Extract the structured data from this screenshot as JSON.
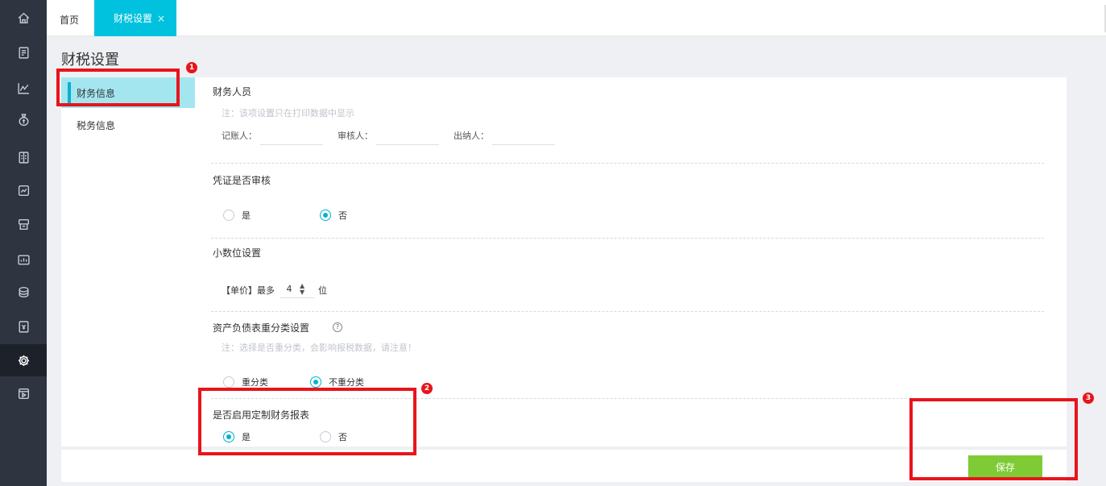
{
  "nav": {
    "icons": [
      "home-icon",
      "document-icon",
      "chart-icon",
      "money-bag-icon",
      "ledger-icon",
      "report-icon",
      "cashier-icon",
      "dashboard-icon",
      "coins-icon",
      "invoice-icon",
      "settings-icon",
      "video-icon"
    ],
    "active": "settings-icon"
  },
  "tabs": {
    "home": "首页",
    "active": "财税设置",
    "close": "×"
  },
  "page": {
    "title": "财税设置"
  },
  "menu": {
    "items": [
      "财务信息",
      "税务信息"
    ]
  },
  "finance": {
    "staff_title": "财务人员",
    "staff_note": "注：该项设置只在打印数据中显示",
    "bookkeeper_label": "记账人：",
    "reviewer_label": "审核人：",
    "cashier_label": "出纳人：",
    "voucher_title": "凭证是否审核",
    "voucher_yes": "是",
    "voucher_no": "否",
    "decimal_title": "小数位设置",
    "decimal_prefix": "【单价】最多",
    "decimal_value": "4",
    "decimal_suffix": "位",
    "balance_title": "资产负债表重分类设置",
    "balance_note": "注：选择是否重分类，会影响报税数据，请注意！",
    "balance_reclass": "重分类",
    "balance_no_reclass": "不重分类",
    "custom_title": "是否启用定制财务报表",
    "custom_yes": "是",
    "custom_no": "否"
  },
  "footer": {
    "save": "保存"
  },
  "annotations": {
    "badge1": "1",
    "badge2": "2",
    "badge3": "3"
  },
  "colors": {
    "accent": "#00c2de",
    "save": "#7ecb35",
    "callout": "#e8141b",
    "sidebar": "#2f3441"
  }
}
